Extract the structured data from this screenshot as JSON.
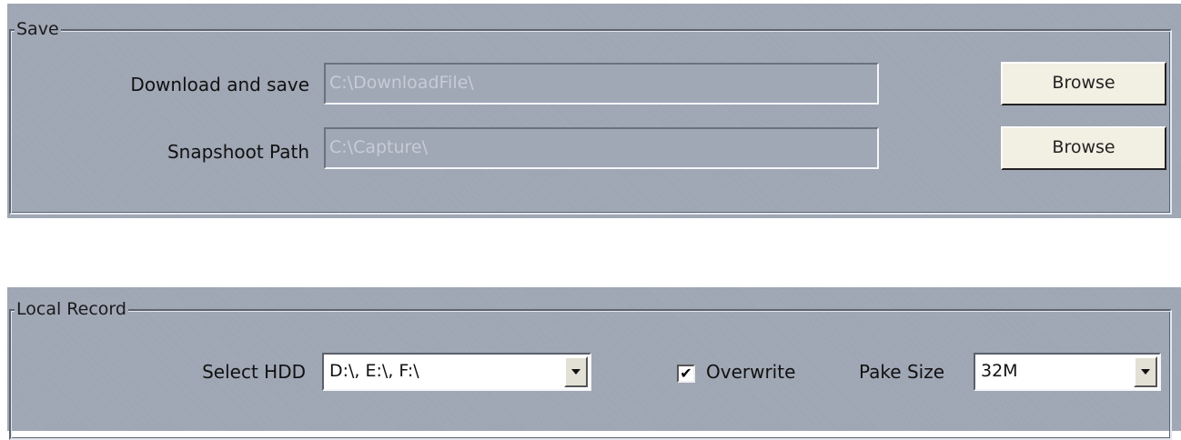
{
  "save": {
    "legend": "Save",
    "download": {
      "label": "Download and save",
      "value": "C:\\DownloadFile\\",
      "button": "Browse"
    },
    "snapshot": {
      "label": "Snapshoot Path",
      "value": "C:\\Capture\\",
      "button": "Browse"
    }
  },
  "local_record": {
    "legend": "Local Record",
    "hdd": {
      "label": "Select HDD",
      "value": "D:\\, E:\\, F:\\"
    },
    "overwrite": {
      "label": "Overwrite",
      "checked": true,
      "mark": "✔"
    },
    "pake_size": {
      "label": "Pake Size",
      "value": "32M"
    }
  }
}
